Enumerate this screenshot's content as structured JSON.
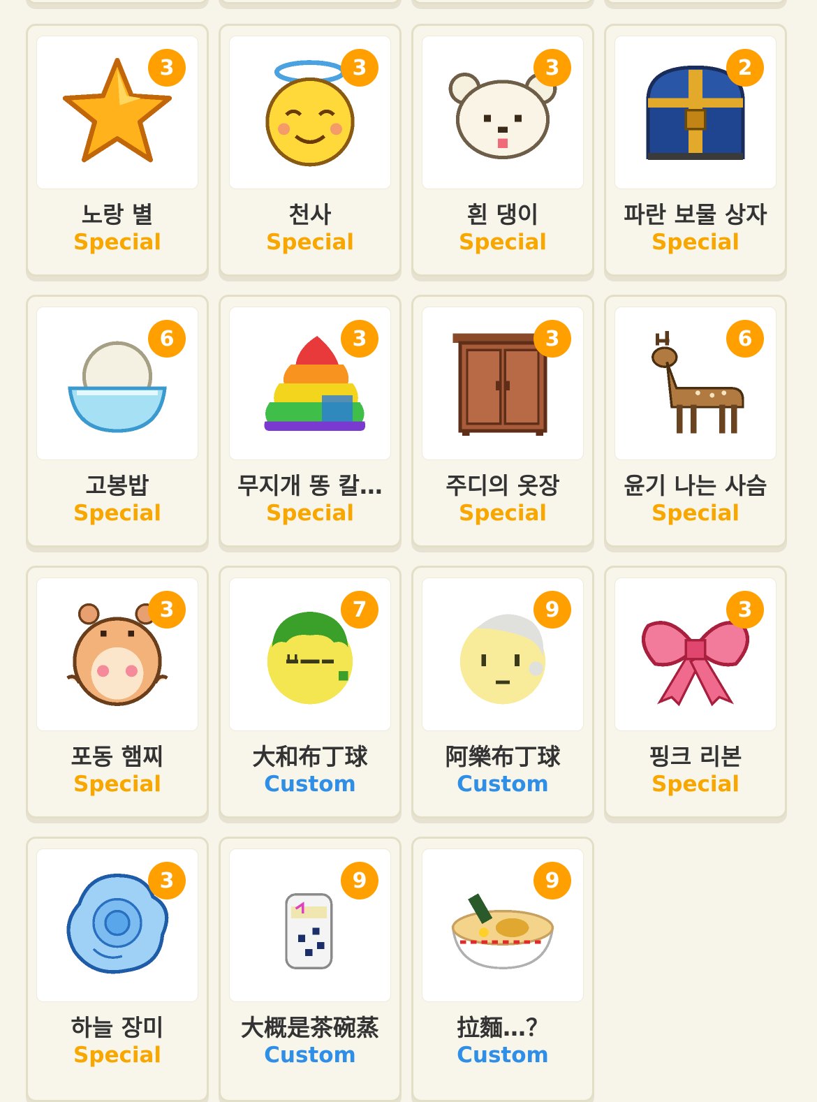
{
  "colors": {
    "special": "#f7a700",
    "custom": "#2f8ee6",
    "badge": "#ff9f00"
  },
  "items": [
    {
      "count": "3",
      "name": "노랑 별",
      "type": "Special",
      "icon": "yellow-star-icon"
    },
    {
      "count": "3",
      "name": "천사",
      "type": "Special",
      "icon": "angel-face-icon"
    },
    {
      "count": "3",
      "name": "흰 댕이",
      "type": "Special",
      "icon": "white-dog-icon"
    },
    {
      "count": "2",
      "name": "파란 보물 상자",
      "type": "Special",
      "icon": "treasure-chest-icon"
    },
    {
      "count": "6",
      "name": "고봉밥",
      "type": "Special",
      "icon": "rice-bowl-icon"
    },
    {
      "count": "3",
      "name": "무지개 똥 칼…",
      "type": "Special",
      "icon": "rainbow-poop-icon"
    },
    {
      "count": "3",
      "name": "주디의 옷장",
      "type": "Special",
      "icon": "wardrobe-icon"
    },
    {
      "count": "6",
      "name": "윤기 나는 사슴",
      "type": "Special",
      "icon": "deer-icon"
    },
    {
      "count": "3",
      "name": "포동 햄찌",
      "type": "Special",
      "icon": "hamster-icon"
    },
    {
      "count": "7",
      "name": "大和布丁球",
      "type": "Custom",
      "icon": "green-hair-face-icon"
    },
    {
      "count": "9",
      "name": "阿樂布丁球",
      "type": "Custom",
      "icon": "white-hair-face-icon"
    },
    {
      "count": "3",
      "name": "핑크 리본",
      "type": "Special",
      "icon": "pink-ribbon-icon"
    },
    {
      "count": "3",
      "name": "하늘 장미",
      "type": "Special",
      "icon": "blue-rose-icon"
    },
    {
      "count": "9",
      "name": "大概是茶碗蒸",
      "type": "Custom",
      "icon": "chawanmushi-icon"
    },
    {
      "count": "9",
      "name": "拉麵…？",
      "type": "Custom",
      "icon": "ramen-bowl-icon"
    }
  ]
}
